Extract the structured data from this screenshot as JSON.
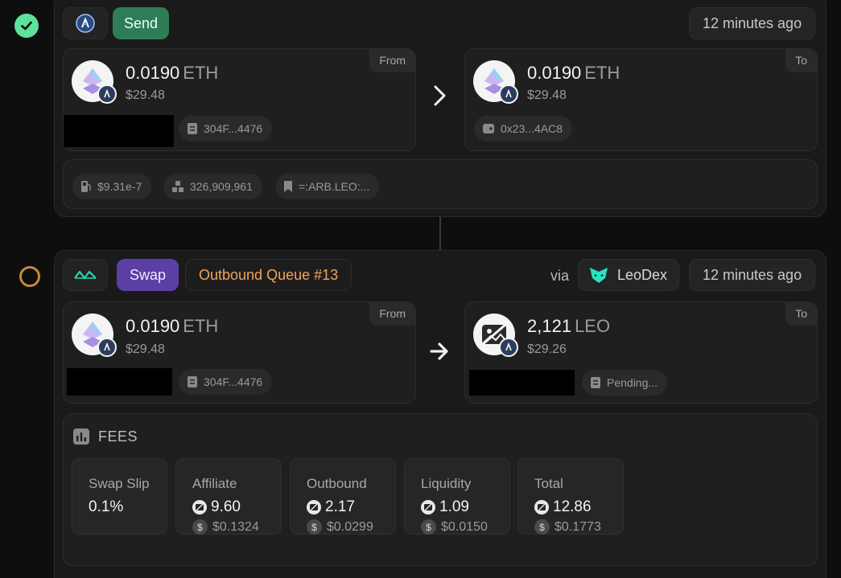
{
  "tx1": {
    "send_label": "Send",
    "time": "12 minutes ago",
    "from": {
      "tag": "From",
      "amount": "0.0190",
      "unit": "ETH",
      "usd": "$29.48",
      "tx_hash": "304F...4476"
    },
    "to": {
      "tag": "To",
      "amount": "0.0190",
      "unit": "ETH",
      "usd": "$29.48",
      "address": "0x23...4AC8"
    },
    "meta": {
      "gas": "$9.31e-7",
      "block": "326,909,961",
      "memo": "=:ARB.LEO:..."
    }
  },
  "tx2": {
    "swap_label": "Swap",
    "queue_label": "Outbound Queue #13",
    "via_label": "via",
    "via_name": "LeoDex",
    "time": "12 minutes ago",
    "from": {
      "tag": "From",
      "amount": "0.0190",
      "unit": "ETH",
      "usd": "$29.48",
      "tx_hash": "304F...4476"
    },
    "to": {
      "tag": "To",
      "amount": "2,121",
      "unit": "LEO",
      "usd": "$29.26",
      "status": "Pending..."
    },
    "fees": {
      "title": "FEES",
      "items": [
        {
          "label": "Swap Slip",
          "value": "0.1%",
          "usd": ""
        },
        {
          "label": "Affiliate",
          "value": "9.60",
          "usd": "$0.1324"
        },
        {
          "label": "Outbound",
          "value": "2.17",
          "usd": "$0.0299"
        },
        {
          "label": "Liquidity",
          "value": "1.09",
          "usd": "$0.0150"
        },
        {
          "label": "Total",
          "value": "12.86",
          "usd": "$0.1773"
        }
      ]
    }
  },
  "colors": {
    "success": "#5ee19a",
    "send": "#2f7d57",
    "swap": "#5b3fa5",
    "queue_text": "#f2a35a",
    "pending_ring": "#c7893b"
  },
  "icons": {
    "status_done": "check-icon",
    "status_pending": "ring-icon",
    "chain": "arbitrum-icon",
    "protocol": "thorchain-icon",
    "leodex": "leodex-icon",
    "gas": "gas-pump-icon",
    "block": "blocks-icon",
    "memo": "bookmark-icon",
    "hash": "document-icon",
    "wallet": "wallet-icon",
    "fees": "bar-chart-icon"
  }
}
